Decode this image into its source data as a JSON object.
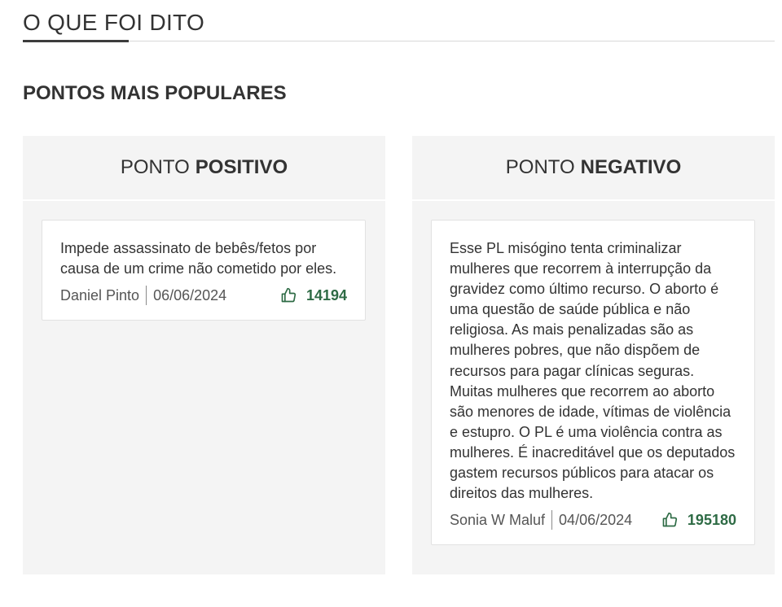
{
  "section": {
    "title": "O QUE FOI DITO"
  },
  "subtitle": "PONTOS MAIS POPULARES",
  "columns": {
    "positive": {
      "prefix": "PONTO",
      "emphasis": "POSITIVO",
      "card": {
        "text": "Impede assassinato de bebês/fetos por causa de um crime não cometido por eles.",
        "author": "Daniel Pinto",
        "date": "06/06/2024",
        "likes": "14194"
      }
    },
    "negative": {
      "prefix": "PONTO",
      "emphasis": "NEGATIVO",
      "card": {
        "text": "Esse PL misógino tenta criminalizar mulheres que recorrem à interrupção da gravidez como último recurso. O aborto é uma questão de saúde pública e não religiosa. As mais penalizadas são as mulheres pobres, que não dispõem de recursos para pagar clínicas seguras. Muitas mulheres que recorrem ao aborto são menores de idade, vítimas de violência e estupro. O PL é uma violência contra as mulheres. É inacreditável que os deputados gastem recursos públicos para atacar os direitos das mulheres.",
        "author": "Sonia W Maluf",
        "date": "04/06/2024",
        "likes": "195180"
      }
    }
  },
  "icons": {
    "like": "thumbs-up-icon"
  },
  "colors": {
    "like_accent": "#2e6b45",
    "panel_bg": "#f4f4f4"
  }
}
